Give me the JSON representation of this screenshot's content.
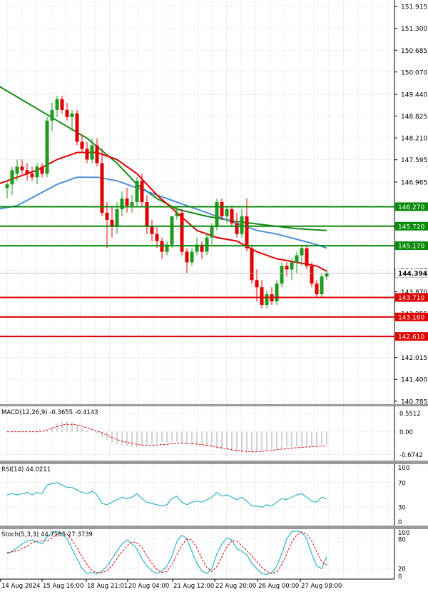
{
  "chart_data": {
    "type": "candlestick",
    "symbol": "USDJPY",
    "timeframe": "H4",
    "price_axis": {
      "ticks": [
        151.915,
        151.3,
        150.685,
        150.07,
        149.44,
        148.825,
        148.21,
        147.595,
        146.965,
        146.27,
        145.72,
        145.17,
        144.48,
        143.87,
        143.255,
        142.015,
        141.4,
        140.785
      ],
      "tick_labels": [
        "151.915",
        "151.300",
        "150.685",
        "150.070",
        "149.440",
        "148.825",
        "148.210",
        "147.595",
        "146.965",
        "146.270",
        "145.720",
        "145.170",
        "144.480",
        "143.870",
        "143.255",
        "142.015",
        "141.400",
        "140.785"
      ],
      "range": [
        140.7,
        152.1
      ]
    },
    "current_price": {
      "value": 144.394,
      "label": "144.394"
    },
    "levels": [
      {
        "value": 146.27,
        "label": "146.270",
        "color": "#0a8a0a"
      },
      {
        "value": 145.72,
        "label": "145.720",
        "color": "#0a8a0a"
      },
      {
        "value": 145.17,
        "label": "145.170",
        "color": "#0a8a0a"
      },
      {
        "value": 143.71,
        "label": "143.710",
        "color": "#e00000"
      },
      {
        "value": 143.16,
        "label": "143.160",
        "color": "#e00000"
      },
      {
        "value": 142.61,
        "label": "142.610",
        "color": "#e00000"
      }
    ],
    "x_labels": [
      "14 Aug 2024",
      "15 Aug 16:00",
      "18 Aug 21:01",
      "20 Aug 04:00",
      "21 Aug 12:00",
      "22 Aug 20:00",
      "26 Aug 00:00",
      "27 Aug 08:00"
    ],
    "candles": [
      [
        146.8,
        147.0,
        146.5,
        146.9
      ],
      [
        146.9,
        147.4,
        146.6,
        147.3
      ],
      [
        147.2,
        147.6,
        147.0,
        147.4
      ],
      [
        147.4,
        147.6,
        147.2,
        147.3
      ],
      [
        147.3,
        147.5,
        147.0,
        147.2
      ],
      [
        147.2,
        147.4,
        147.0,
        147.1
      ],
      [
        147.1,
        147.5,
        146.9,
        147.4
      ],
      [
        147.4,
        147.5,
        147.1,
        147.2
      ],
      [
        147.2,
        148.8,
        147.1,
        148.7
      ],
      [
        148.7,
        149.2,
        148.4,
        149.0
      ],
      [
        149.0,
        149.4,
        148.8,
        149.3
      ],
      [
        149.3,
        149.4,
        148.9,
        149.0
      ],
      [
        149.0,
        149.2,
        148.7,
        148.8
      ],
      [
        148.8,
        149.0,
        148.4,
        148.9
      ],
      [
        148.9,
        149.0,
        148.0,
        148.1
      ],
      [
        148.1,
        148.3,
        147.8,
        147.9
      ],
      [
        147.9,
        148.1,
        147.5,
        147.6
      ],
      [
        147.6,
        148.2,
        147.5,
        148.0
      ],
      [
        148.0,
        148.2,
        147.4,
        147.5
      ],
      [
        147.5,
        147.9,
        146.0,
        146.1
      ],
      [
        146.1,
        146.4,
        145.1,
        145.9
      ],
      [
        145.9,
        146.3,
        145.4,
        145.7
      ],
      [
        145.7,
        146.4,
        145.5,
        146.2
      ],
      [
        146.2,
        146.7,
        146.0,
        146.5
      ],
      [
        146.5,
        146.8,
        146.1,
        146.3
      ],
      [
        146.3,
        146.6,
        146.1,
        146.4
      ],
      [
        146.4,
        147.1,
        146.3,
        147.0
      ],
      [
        147.0,
        147.2,
        146.3,
        146.4
      ],
      [
        146.4,
        146.6,
        145.5,
        145.7
      ],
      [
        145.7,
        145.9,
        145.3,
        145.5
      ],
      [
        145.5,
        145.7,
        145.1,
        145.3
      ],
      [
        145.3,
        145.4,
        144.8,
        145.0
      ],
      [
        145.0,
        145.3,
        144.9,
        145.2
      ],
      [
        145.2,
        146.0,
        145.1,
        146.0
      ],
      [
        146.0,
        146.3,
        145.9,
        146.1
      ],
      [
        146.1,
        146.2,
        144.9,
        145.0
      ],
      [
        145.0,
        145.1,
        144.4,
        144.7
      ],
      [
        144.7,
        145.1,
        144.6,
        145.0
      ],
      [
        145.0,
        145.4,
        144.9,
        145.2
      ],
      [
        145.2,
        145.3,
        144.8,
        145.0
      ],
      [
        145.0,
        145.5,
        144.9,
        145.4
      ],
      [
        145.4,
        145.8,
        145.2,
        145.7
      ],
      [
        145.7,
        146.5,
        145.6,
        146.4
      ],
      [
        146.4,
        146.5,
        145.9,
        146.0
      ],
      [
        146.0,
        146.3,
        145.8,
        146.2
      ],
      [
        146.2,
        146.3,
        145.7,
        145.8
      ],
      [
        145.8,
        146.1,
        145.4,
        145.5
      ],
      [
        145.5,
        146.2,
        145.4,
        146.0
      ],
      [
        146.0,
        146.5,
        145.0,
        145.1
      ],
      [
        145.1,
        145.2,
        144.1,
        144.2
      ],
      [
        144.2,
        144.5,
        143.6,
        144.0
      ],
      [
        144.0,
        144.2,
        143.4,
        143.5
      ],
      [
        143.5,
        143.9,
        143.4,
        143.8
      ],
      [
        143.8,
        144.0,
        143.5,
        143.6
      ],
      [
        143.6,
        144.2,
        143.5,
        144.1
      ],
      [
        144.1,
        144.7,
        144.0,
        144.6
      ],
      [
        144.6,
        144.7,
        144.3,
        144.5
      ],
      [
        144.5,
        144.8,
        144.2,
        144.7
      ],
      [
        144.7,
        145.0,
        144.4,
        144.9
      ],
      [
        144.9,
        145.2,
        144.6,
        145.1
      ],
      [
        145.1,
        145.2,
        144.5,
        144.6
      ],
      [
        144.6,
        144.7,
        144.0,
        144.1
      ],
      [
        144.1,
        144.2,
        143.7,
        143.8
      ],
      [
        143.8,
        144.4,
        143.7,
        144.3
      ],
      [
        144.3,
        144.5,
        144.2,
        144.39
      ]
    ],
    "colors": {
      "bull": "#1e9a1e",
      "bear": "#e00000",
      "ma_fast": "#e00000",
      "ma_mid": "#4a90d9",
      "ma_slow": "#1a8a1a",
      "signal": "#e00000",
      "rsi": "#2fb5c8",
      "stoch_main": "#2fb5c8",
      "stoch_signal": "#e00000"
    },
    "moving_averages": {
      "fast": {
        "color": "#e00000",
        "points": [
          [
            -2,
            146.9
          ],
          [
            2,
            147.1
          ],
          [
            6,
            147.3
          ],
          [
            10,
            147.6
          ],
          [
            14,
            147.8
          ],
          [
            18,
            147.8
          ],
          [
            22,
            147.6
          ],
          [
            26,
            147.2
          ],
          [
            30,
            146.6
          ],
          [
            34,
            146.1
          ],
          [
            38,
            145.6
          ],
          [
            42,
            145.4
          ],
          [
            46,
            145.3
          ],
          [
            50,
            145.0
          ],
          [
            54,
            144.8
          ],
          [
            58,
            144.7
          ],
          [
            62,
            144.6
          ],
          [
            64,
            144.45
          ]
        ]
      },
      "mid": {
        "color": "#4a90d9",
        "points": [
          [
            -2,
            146.2
          ],
          [
            2,
            146.3
          ],
          [
            6,
            146.6
          ],
          [
            10,
            146.9
          ],
          [
            14,
            147.1
          ],
          [
            18,
            147.1
          ],
          [
            22,
            147.0
          ],
          [
            26,
            146.8
          ],
          [
            30,
            146.6
          ],
          [
            34,
            146.4
          ],
          [
            38,
            146.2
          ],
          [
            42,
            146.0
          ],
          [
            46,
            145.8
          ],
          [
            50,
            145.6
          ],
          [
            54,
            145.5
          ],
          [
            58,
            145.35
          ],
          [
            62,
            145.2
          ],
          [
            64,
            145.1
          ]
        ]
      },
      "slow": {
        "color": "#1a8a1a",
        "points": [
          [
            -2,
            149.7
          ],
          [
            4,
            149.2
          ],
          [
            10,
            148.7
          ],
          [
            16,
            148.2
          ],
          [
            22,
            147.5
          ],
          [
            26,
            146.9
          ],
          [
            30,
            146.5
          ],
          [
            34,
            146.2
          ],
          [
            40,
            146.0
          ],
          [
            46,
            145.85
          ],
          [
            52,
            145.75
          ],
          [
            58,
            145.65
          ],
          [
            64,
            145.6
          ]
        ]
      }
    },
    "macd": {
      "label": "MACD(12,26,9) -0.3655 -0.4143",
      "ticks": [
        0.5512,
        0.0,
        -0.6742
      ],
      "tick_labels": [
        "0.5512",
        "0.00",
        "-0.6742"
      ],
      "range": [
        -0.85,
        0.75
      ],
      "histogram": [
        0.0,
        0.0,
        0.0,
        0.0,
        0.0,
        0.0,
        0.0,
        0.0,
        0.05,
        0.15,
        0.25,
        0.3,
        0.3,
        0.28,
        0.2,
        0.12,
        0.05,
        0.0,
        -0.05,
        -0.15,
        -0.25,
        -0.33,
        -0.38,
        -0.4,
        -0.42,
        -0.45,
        -0.45,
        -0.42,
        -0.4,
        -0.38,
        -0.35,
        -0.32,
        -0.3,
        -0.28,
        -0.3,
        -0.34,
        -0.38,
        -0.4,
        -0.42,
        -0.42,
        -0.44,
        -0.48,
        -0.5,
        -0.52,
        -0.55,
        -0.58,
        -0.6,
        -0.6,
        -0.62,
        -0.62,
        -0.6,
        -0.58,
        -0.55,
        -0.52,
        -0.5,
        -0.48,
        -0.46,
        -0.45,
        -0.44,
        -0.44,
        -0.43,
        -0.42,
        -0.4,
        -0.38,
        -0.37
      ],
      "signal": [
        0.0,
        0.0,
        0.0,
        0.0,
        0.0,
        0.0,
        0.0,
        0.02,
        0.05,
        0.1,
        0.15,
        0.2,
        0.22,
        0.22,
        0.2,
        0.16,
        0.12,
        0.07,
        0.02,
        -0.03,
        -0.1,
        -0.17,
        -0.23,
        -0.28,
        -0.31,
        -0.34,
        -0.37,
        -0.39,
        -0.4,
        -0.4,
        -0.39,
        -0.38,
        -0.37,
        -0.35,
        -0.34,
        -0.33,
        -0.34,
        -0.35,
        -0.36,
        -0.38,
        -0.4,
        -0.42,
        -0.45,
        -0.47,
        -0.5,
        -0.53,
        -0.55,
        -0.57,
        -0.58,
        -0.59,
        -0.59,
        -0.58,
        -0.56,
        -0.55,
        -0.53,
        -0.51,
        -0.5,
        -0.48,
        -0.47,
        -0.46,
        -0.45,
        -0.44,
        -0.43,
        -0.42,
        -0.41
      ]
    },
    "rsi": {
      "label": "RSI(14) 44.0211",
      "ticks": [
        100,
        70,
        30,
        0
      ],
      "tick_labels": [
        "100",
        "70",
        "30",
        "0"
      ],
      "range": [
        0,
        100
      ],
      "values": [
        50,
        52,
        50,
        52,
        54,
        50,
        54,
        52,
        66,
        68,
        70,
        66,
        62,
        62,
        58,
        54,
        52,
        56,
        50,
        36,
        34,
        38,
        42,
        46,
        44,
        46,
        52,
        44,
        38,
        36,
        34,
        32,
        34,
        44,
        48,
        38,
        34,
        38,
        40,
        38,
        42,
        46,
        54,
        48,
        50,
        46,
        42,
        46,
        40,
        32,
        32,
        30,
        34,
        32,
        38,
        44,
        42,
        46,
        50,
        52,
        46,
        40,
        38,
        46,
        44
      ]
    },
    "stoch": {
      "label": "Stoch(5,3,3) 44.7165 27.3739",
      "ticks": [
        100,
        80,
        20,
        0
      ],
      "tick_labels": [
        "100",
        "80",
        "20",
        "0"
      ],
      "range": [
        0,
        100
      ],
      "main": [
        50,
        55,
        62,
        70,
        76,
        78,
        74,
        70,
        85,
        92,
        96,
        90,
        80,
        60,
        40,
        20,
        10,
        12,
        10,
        15,
        25,
        40,
        55,
        70,
        78,
        70,
        60,
        40,
        25,
        15,
        10,
        15,
        25,
        45,
        75,
        88,
        80,
        55,
        30,
        15,
        10,
        20,
        50,
        70,
        82,
        78,
        60,
        55,
        48,
        30,
        20,
        10,
        8,
        12,
        25,
        50,
        80,
        95,
        96,
        94,
        80,
        50,
        25,
        20,
        44.7
      ],
      "signal": [
        52,
        54,
        56,
        60,
        66,
        72,
        76,
        76,
        76,
        82,
        90,
        92,
        90,
        78,
        62,
        44,
        28,
        16,
        12,
        12,
        16,
        26,
        40,
        54,
        66,
        74,
        72,
        62,
        46,
        30,
        18,
        12,
        14,
        28,
        48,
        68,
        80,
        78,
        62,
        40,
        22,
        14,
        24,
        44,
        64,
        76,
        76,
        66,
        56,
        46,
        34,
        22,
        14,
        10,
        14,
        28,
        50,
        74,
        88,
        94,
        90,
        76,
        54,
        34,
        27.4
      ]
    }
  }
}
